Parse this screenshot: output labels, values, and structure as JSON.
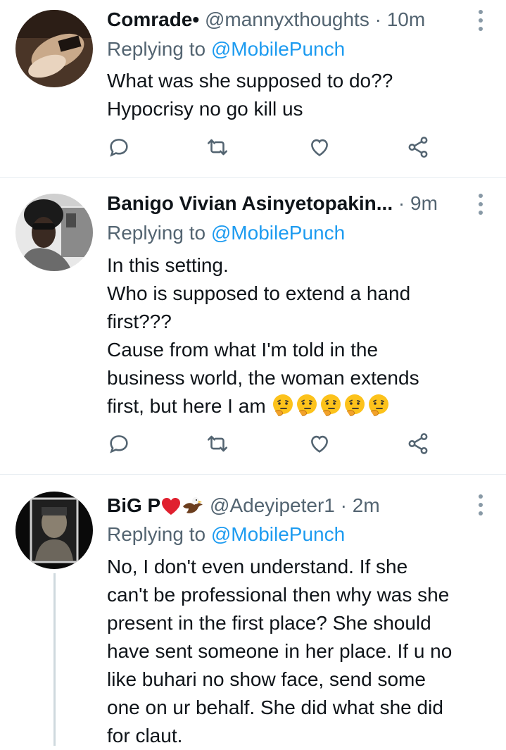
{
  "tweets": [
    {
      "name": "Comrade•",
      "handle": "@mannyxthoughts",
      "time": "· 10m",
      "replying_prefix": "Replying to",
      "replying_to": "@MobilePunch",
      "lines": [
        "What was she supposed to do??",
        "Hypocrisy no go kill us"
      ]
    },
    {
      "name": "Banigo Vivian Asinyetopakin...",
      "handle": "",
      "time": "· 9m",
      "replying_prefix": "Replying to",
      "replying_to": "@MobilePunch",
      "lines": [
        "In this setting.",
        "Who is supposed to extend a hand",
        "first???",
        "Cause from what I'm told in the",
        "business world, the woman extends",
        "first, but here I am"
      ]
    },
    {
      "name": "BiG P",
      "handle": "@Adeyipeter1",
      "time": "· 2m",
      "replying_prefix": "Replying to",
      "replying_to": "@MobilePunch",
      "lines": [
        "No, I don't even understand.  If she",
        "can't be professional then why was she",
        "present in the first place? She should",
        "have sent someone in her place. If u no",
        "like buhari no show face, send some",
        "one on ur behalf. She did what she did",
        "for claut."
      ]
    }
  ],
  "icons": {
    "reply": "speech-bubble-icon",
    "retweet": "retweet-icon",
    "like": "heart-icon",
    "share": "share-icon",
    "more": "more-vertical-icon",
    "thinking": "thinking-face-emoji",
    "name_emoji_1": "red-heart-emoji",
    "name_emoji_2": "eagle-emoji"
  },
  "colors": {
    "link": "#1d9bf0",
    "secondary_text": "#536471",
    "icon": "#536471",
    "divider": "#e6ecf0"
  }
}
